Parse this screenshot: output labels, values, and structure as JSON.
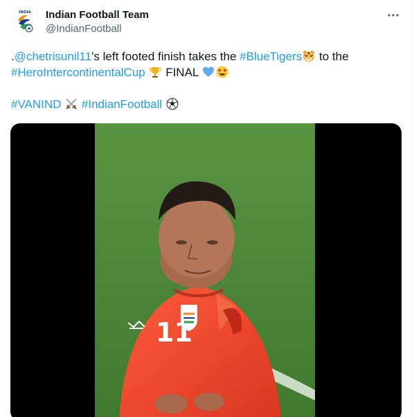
{
  "tweet": {
    "display_name": "Indian Football Team",
    "handle": "@IndianFootball",
    "more_icon": "ellipsis-icon",
    "avatar_logo_text": "INDIA",
    "text": {
      "line1_prefix": ".",
      "mention": "@chetrisunil11",
      "line1_mid": "'s left footed finish takes the ",
      "hashtag_blue_tigers": "#BlueTigers",
      "line1_suffix": " to the",
      "hashtag_hero_cup": "#HeroIntercontinentalCup",
      "line2_suffix": " FINAL ",
      "hashtag_vanind": "#VANIND",
      "hashtag_indian_football": "#IndianFootball"
    },
    "emojis": [
      "tiger-face-icon",
      "trophy-icon",
      "blue-heart-icon",
      "heart-eyes-icon",
      "crossed-swords-icon",
      "soccer-ball-icon"
    ],
    "media": {
      "type": "video",
      "jersey_number": "11"
    },
    "colors": {
      "link": "#1d9bf0",
      "text": "#0f1419",
      "secondary": "#536471",
      "jersey": "#e8452f",
      "pitch": "#4f8c3a"
    }
  }
}
